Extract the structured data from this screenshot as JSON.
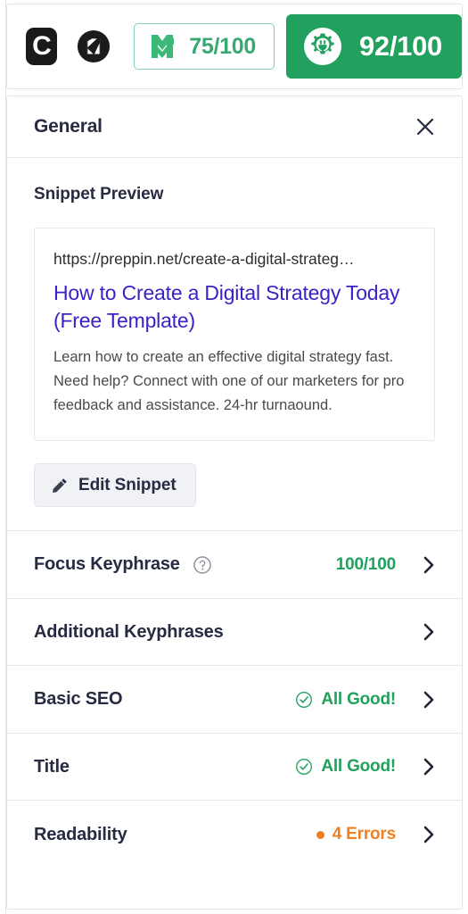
{
  "toolbar": {
    "logo_c_letter": "C",
    "logo_c_name": "clearscope-logo",
    "logo_b_name": "brand-circle-logo",
    "seo_score_pill": {
      "icon": "monsterinsights-m-icon",
      "value": "75/100"
    },
    "seo_score_solid": {
      "icon": "aioseo-gear-plug-icon",
      "value": "92/100"
    }
  },
  "panel": {
    "title": "General",
    "close_label": "close-icon"
  },
  "snippet": {
    "heading": "Snippet Preview",
    "url": "https://preppin.net/create-a-digital-strateg…",
    "title": "How to Create a Digital Strategy Today (Free Template)",
    "description": "Learn how to create an effective digital strategy fast. Need help? Connect with one of our marketers for pro feedback and assistance. 24-hr turnaound.",
    "edit_button": "Edit Snippet"
  },
  "rows": [
    {
      "label": "Focus Keyphrase",
      "has_help": true,
      "status": "100/100",
      "status_kind": "green",
      "status_icon": "none"
    },
    {
      "label": "Additional Keyphrases",
      "has_help": false,
      "status": "",
      "status_kind": "none",
      "status_icon": "none"
    },
    {
      "label": "Basic SEO",
      "has_help": false,
      "status": "All Good!",
      "status_kind": "green",
      "status_icon": "check-circle"
    },
    {
      "label": "Title",
      "has_help": false,
      "status": "All Good!",
      "status_kind": "green",
      "status_icon": "check-circle"
    },
    {
      "label": "Readability",
      "has_help": false,
      "status": "4 Errors",
      "status_kind": "orange",
      "status_icon": "dot"
    }
  ],
  "colors": {
    "green": "#22a05e",
    "green_light": "#3aa873",
    "orange": "#ef8022",
    "link_blue": "#3823c4",
    "navy": "#272b41"
  }
}
